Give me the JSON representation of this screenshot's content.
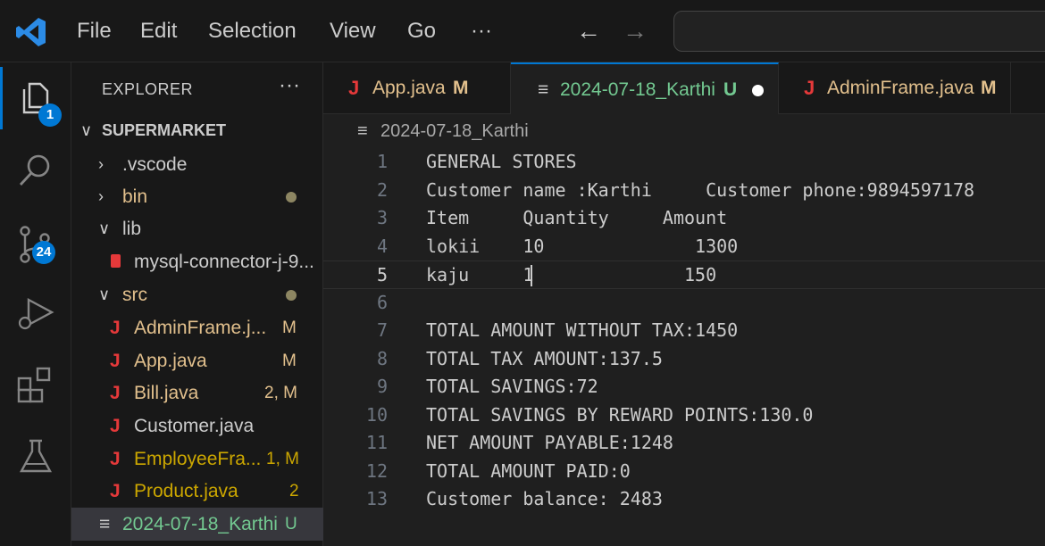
{
  "menu": {
    "file": "File",
    "edit": "Edit",
    "selection": "Selection",
    "view": "View",
    "go": "Go",
    "more": "···"
  },
  "nav": {
    "back": "←",
    "forward": "→"
  },
  "activity": {
    "explorer_badge": "1",
    "scm_badge": "24"
  },
  "sidebar": {
    "title": "EXPLORER",
    "more": "···",
    "project": "SUPERMARKET",
    "items": [
      {
        "label": ".vscode",
        "status": ""
      },
      {
        "label": "bin",
        "status": ""
      },
      {
        "label": "lib",
        "status": ""
      },
      {
        "label": "mysql-connector-j-9...",
        "status": ""
      },
      {
        "label": "src",
        "status": ""
      },
      {
        "label": "AdminFrame.j...",
        "status": "M"
      },
      {
        "label": "App.java",
        "status": "M"
      },
      {
        "label": "Bill.java",
        "status": "2, M"
      },
      {
        "label": "Customer.java",
        "status": ""
      },
      {
        "label": "EmployeeFra...",
        "status": "1, M"
      },
      {
        "label": "Product.java",
        "status": "2"
      },
      {
        "label": "2024-07-18_Karthi",
        "status": "U"
      }
    ]
  },
  "tabs": [
    {
      "icon": "J",
      "label": "App.java",
      "status": "M"
    },
    {
      "icon": "≡",
      "label": "2024-07-18_Karthi",
      "status": "U"
    },
    {
      "icon": "J",
      "label": "AdminFrame.java",
      "status": "M"
    }
  ],
  "breadcrumb": "2024-07-18_Karthi",
  "editor": {
    "lines": [
      {
        "n": "1",
        "text": "GENERAL STORES"
      },
      {
        "n": "2",
        "text": "Customer name :Karthi     Customer phone:9894597178"
      },
      {
        "n": "3",
        "text": "Item     Quantity     Amount"
      },
      {
        "n": "4",
        "text": "lokii    10              1300"
      },
      {
        "n": "5",
        "text": "kaju     1              150"
      },
      {
        "n": "6",
        "text": ""
      },
      {
        "n": "7",
        "text": "TOTAL AMOUNT WITHOUT TAX:1450"
      },
      {
        "n": "8",
        "text": "TOTAL TAX AMOUNT:137.5"
      },
      {
        "n": "9",
        "text": "TOTAL SAVINGS:72"
      },
      {
        "n": "10",
        "text": "TOTAL SAVINGS BY REWARD POINTS:130.0"
      },
      {
        "n": "11",
        "text": "NET AMOUNT PAYABLE:1248"
      },
      {
        "n": "12",
        "text": "TOTAL AMOUNT PAID:0"
      },
      {
        "n": "13",
        "text": "Customer balance: 2483"
      }
    ]
  },
  "colors": {
    "accent": "#0078d4",
    "modified": "#e2c08d",
    "untracked": "#73c991",
    "java_icon": "#e5393a"
  }
}
